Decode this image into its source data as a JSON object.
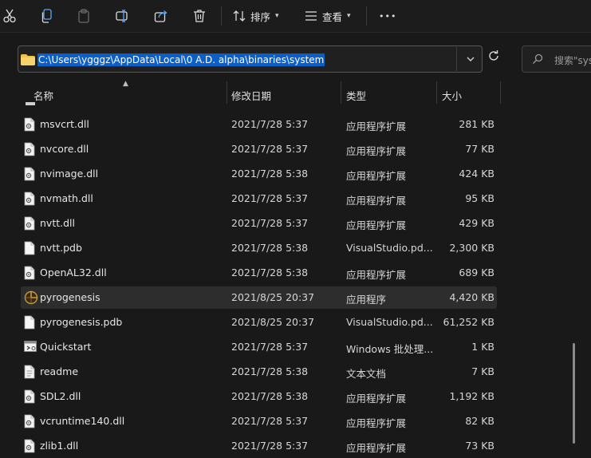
{
  "toolbar": {
    "sort_label": "排序",
    "view_label": "查看",
    "more_label": "•••"
  },
  "address": {
    "path": "C:\\Users\\ygggz\\AppData\\Local\\0 A.D. alpha\\binaries\\system"
  },
  "search": {
    "placeholder": "搜索\"sys"
  },
  "columns": {
    "name": "名称",
    "date": "修改日期",
    "type": "类型",
    "size": "大小"
  },
  "files": [
    {
      "name": "msvcrt.dll",
      "date": "2021/7/28 5:37",
      "type": "应用程序扩展",
      "size": "281 KB",
      "icon": "dll-file-icon"
    },
    {
      "name": "nvcore.dll",
      "date": "2021/7/28 5:37",
      "type": "应用程序扩展",
      "size": "77 KB",
      "icon": "dll-file-icon"
    },
    {
      "name": "nvimage.dll",
      "date": "2021/7/28 5:38",
      "type": "应用程序扩展",
      "size": "424 KB",
      "icon": "dll-file-icon"
    },
    {
      "name": "nvmath.dll",
      "date": "2021/7/28 5:37",
      "type": "应用程序扩展",
      "size": "95 KB",
      "icon": "dll-file-icon"
    },
    {
      "name": "nvtt.dll",
      "date": "2021/7/28 5:37",
      "type": "应用程序扩展",
      "size": "429 KB",
      "icon": "dll-file-icon"
    },
    {
      "name": "nvtt.pdb",
      "date": "2021/7/28 5:38",
      "type": "VisualStudio.pd...",
      "size": "2,300 KB",
      "icon": "blank-file-icon"
    },
    {
      "name": "OpenAL32.dll",
      "date": "2021/7/28 5:38",
      "type": "应用程序扩展",
      "size": "689 KB",
      "icon": "dll-file-icon"
    },
    {
      "name": "pyrogenesis",
      "date": "2021/8/25 20:37",
      "type": "应用程序",
      "size": "4,420 KB",
      "icon": "app-exe-icon",
      "selected": true
    },
    {
      "name": "pyrogenesis.pdb",
      "date": "2021/8/25 20:37",
      "type": "VisualStudio.pd...",
      "size": "61,252 KB",
      "icon": "blank-file-icon"
    },
    {
      "name": "Quickstart",
      "date": "2021/7/28 5:37",
      "type": "Windows 批处理...",
      "size": "1 KB",
      "icon": "batch-file-icon"
    },
    {
      "name": "readme",
      "date": "2021/7/28 5:38",
      "type": "文本文档",
      "size": "7 KB",
      "icon": "text-file-icon"
    },
    {
      "name": "SDL2.dll",
      "date": "2021/7/28 5:38",
      "type": "应用程序扩展",
      "size": "1,192 KB",
      "icon": "dll-file-icon"
    },
    {
      "name": "vcruntime140.dll",
      "date": "2021/7/28 5:37",
      "type": "应用程序扩展",
      "size": "82 KB",
      "icon": "dll-file-icon"
    },
    {
      "name": "zlib1.dll",
      "date": "2021/7/28 5:37",
      "type": "应用程序扩展",
      "size": "73 KB",
      "icon": "dll-file-icon"
    }
  ],
  "colors": {
    "background": "#191919",
    "selection": "#0a5fc8",
    "row_selected": "#2d2d2d"
  }
}
